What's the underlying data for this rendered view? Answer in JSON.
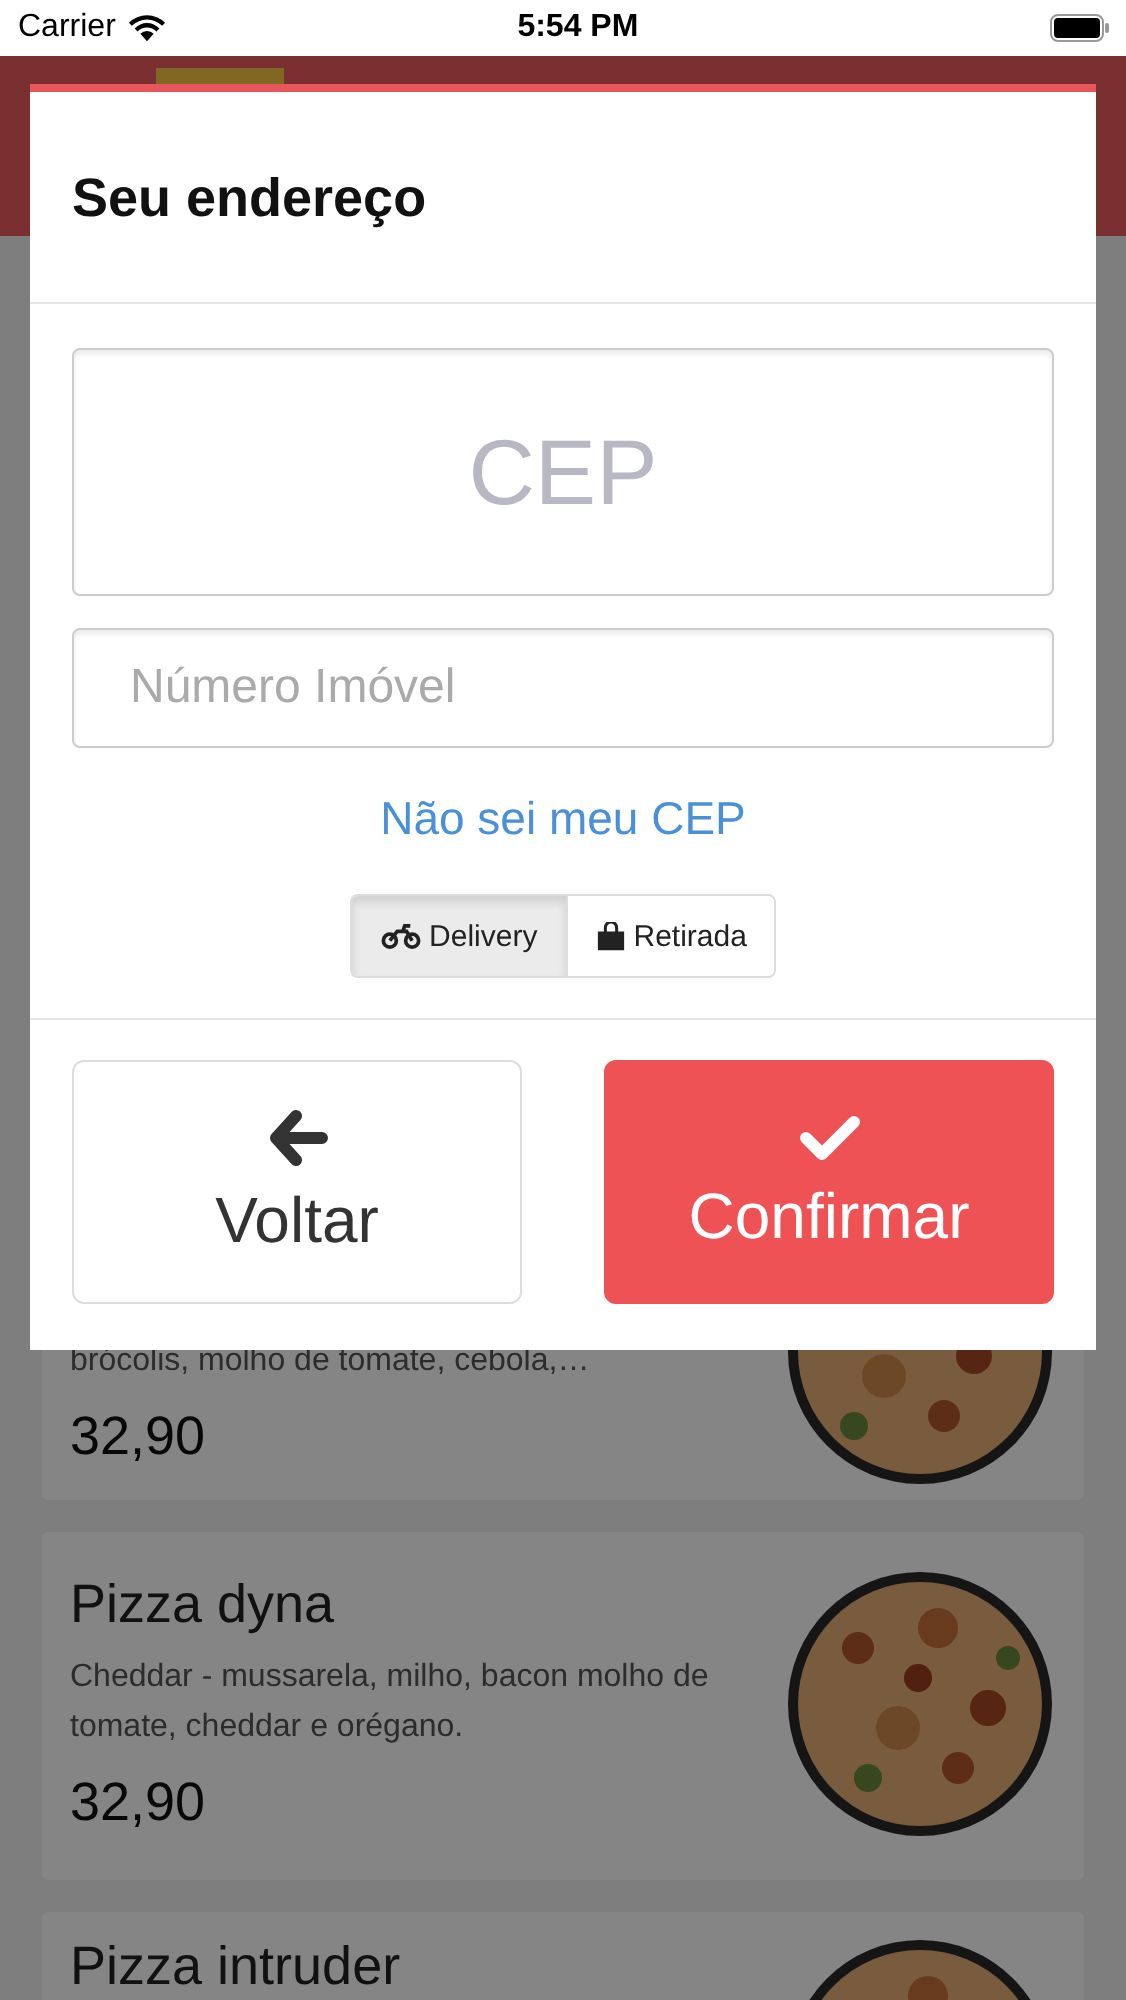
{
  "status_bar": {
    "carrier": "Carrier",
    "time": "5:54 PM"
  },
  "menu": {
    "items": [
      {
        "description": "brócolis, molho de tomate, cebola,…",
        "price": "32,90"
      },
      {
        "name": "Pizza dyna",
        "description": "Cheddar - mussarela, milho, bacon molho de tomate, cheddar e orégano.",
        "price": "32,90"
      },
      {
        "name": "Pizza intruder"
      }
    ]
  },
  "modal": {
    "title": "Seu endereço",
    "fields": [
      {
        "kind": "cep",
        "placeholder": "CEP"
      },
      {
        "kind": "number",
        "placeholder": "Número Imóvel"
      }
    ],
    "link": "Não sei meu CEP",
    "options": [
      {
        "kind": "delivery",
        "label": "Delivery",
        "selected": true
      },
      {
        "kind": "pickup",
        "label": "Retirada",
        "selected": false
      }
    ],
    "buttons": [
      {
        "kind": "back",
        "label": "Voltar"
      },
      {
        "kind": "confirm",
        "label": "Confirmar"
      }
    ]
  }
}
